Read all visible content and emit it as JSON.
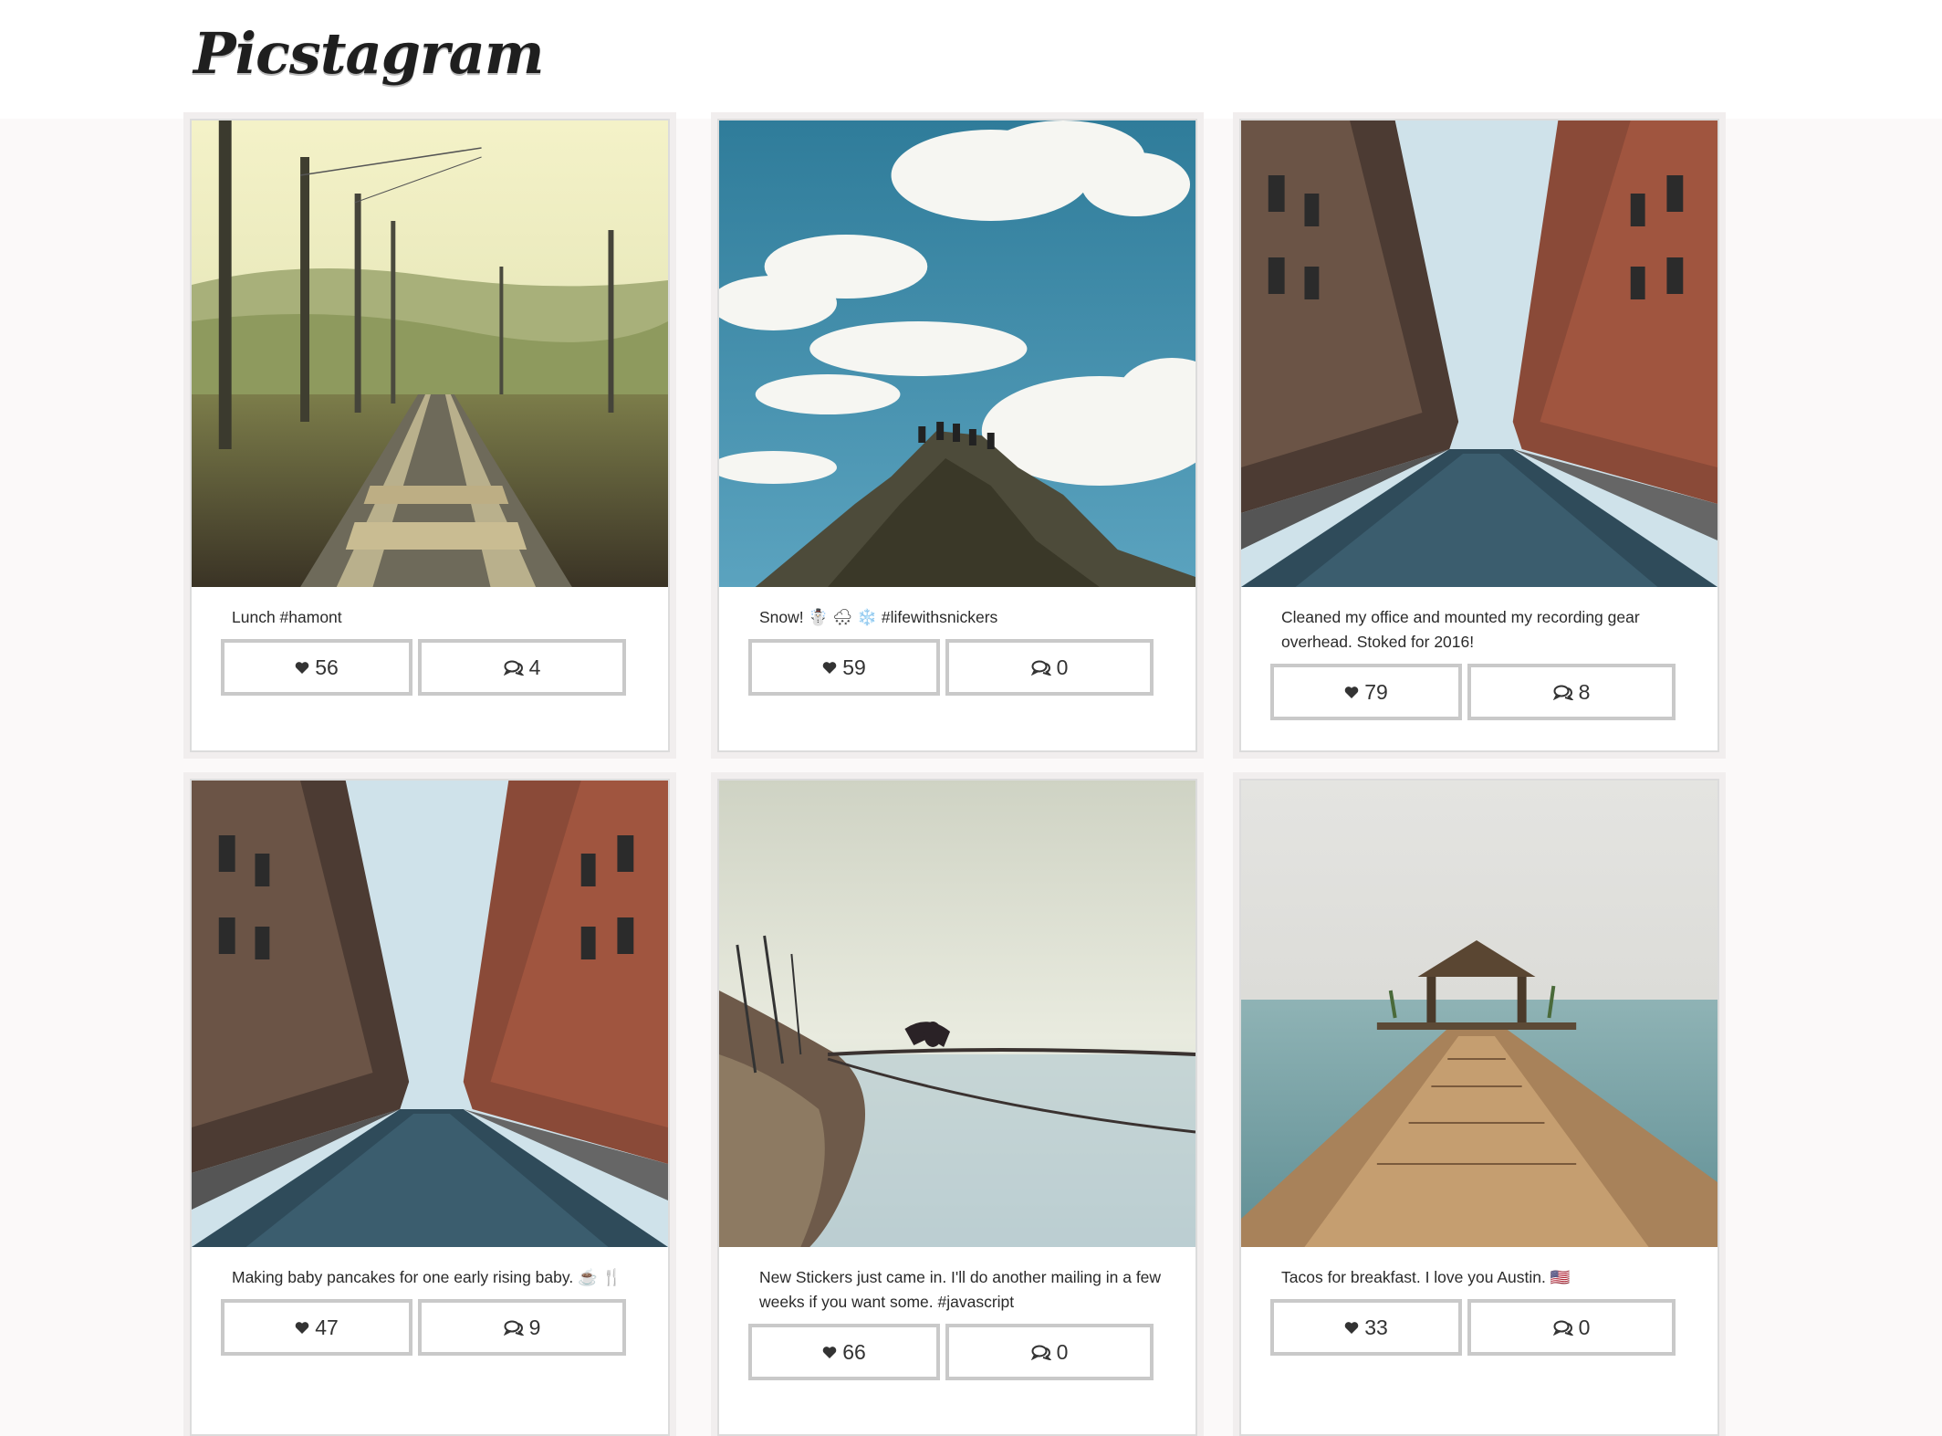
{
  "app": {
    "title": "Picstagram"
  },
  "posts": [
    {
      "caption": "Lunch #hamont",
      "likes": "56",
      "comments": "4",
      "photo": "railway-tracks"
    },
    {
      "caption": "Snow! ☃️ 🌨 ❄️ #lifewithsnickers",
      "likes": "59",
      "comments": "0",
      "photo": "mountain-sky"
    },
    {
      "caption": "Cleaned my office and mounted my recording gear overhead. Stoked for 2016!",
      "likes": "79",
      "comments": "8",
      "photo": "city-street"
    },
    {
      "caption": "Making baby pancakes for one early rising baby. ☕️ 🍴",
      "likes": "47",
      "comments": "9",
      "photo": "city-street"
    },
    {
      "caption": "New Stickers just came in. I'll do another mailing in a few weeks if you want some. #javascript",
      "likes": "66",
      "comments": "0",
      "photo": "bird-on-rope"
    },
    {
      "caption": "Tacos for breakfast. I love you Austin. 🇺🇸",
      "likes": "33",
      "comments": "0",
      "photo": "pier-gazebo"
    }
  ],
  "icons": {
    "like": "heart-icon",
    "comment": "comment-bubbles-icon"
  },
  "colors": {
    "page_bg": "#fbf9f9",
    "card_border": "#dcdcdc",
    "button_border": "#c9c9c9"
  }
}
